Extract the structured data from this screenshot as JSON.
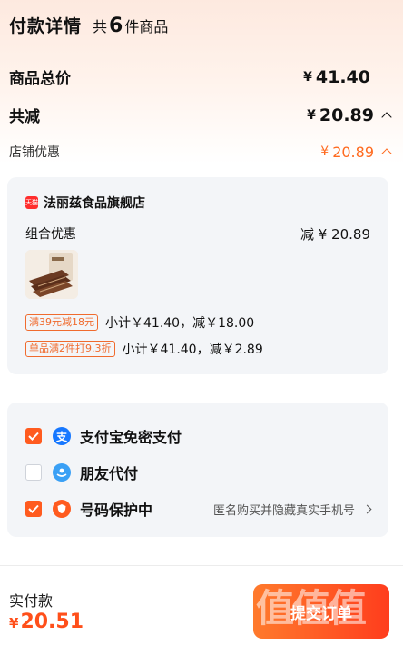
{
  "header": {
    "title": "付款详情",
    "count_prefix": "共",
    "count": "6",
    "count_suffix": "件商品"
  },
  "summary": {
    "total_label": "商品总价",
    "total_yen": "¥",
    "total_value": "41.40",
    "discount_label": "共减",
    "discount_yen": "¥",
    "discount_value": "20.89"
  },
  "store_discount": {
    "label": "店铺优惠",
    "yen": "¥",
    "value": "20.89"
  },
  "shop": {
    "badge": "天猫",
    "name": "法丽兹食品旗舰店",
    "combo_label": "组合优惠",
    "combo_value": "减 ¥ 20.89",
    "promos": [
      {
        "tag": "满39元减18元",
        "text": "小计￥41.40，减￥18.00"
      },
      {
        "tag": "单品满2件打9.3折",
        "text": "小计￥41.40，减￥2.89"
      }
    ]
  },
  "payment": {
    "options": [
      {
        "label": "支付宝免密支付",
        "checked": true,
        "icon": "alipay-icon"
      },
      {
        "label": "朋友代付",
        "checked": false,
        "icon": "friend-pay-icon"
      },
      {
        "label": "号码保护中",
        "checked": true,
        "icon": "shield-icon",
        "desc": "匿名购买并隐藏真实手机号"
      }
    ]
  },
  "footer": {
    "pay_label": "实付款",
    "yen": "¥",
    "pay_value": "20.51",
    "submit_label": "提交订单"
  },
  "watermark": {
    "big": "值值值",
    "url": "zhizhizhi.com"
  },
  "colors": {
    "accent": "#ff5b1f",
    "discount_orange": "#ff6a1f",
    "alipay": "#1677ff",
    "friend": "#3aa0f5",
    "shield": "#ff5b1f"
  }
}
